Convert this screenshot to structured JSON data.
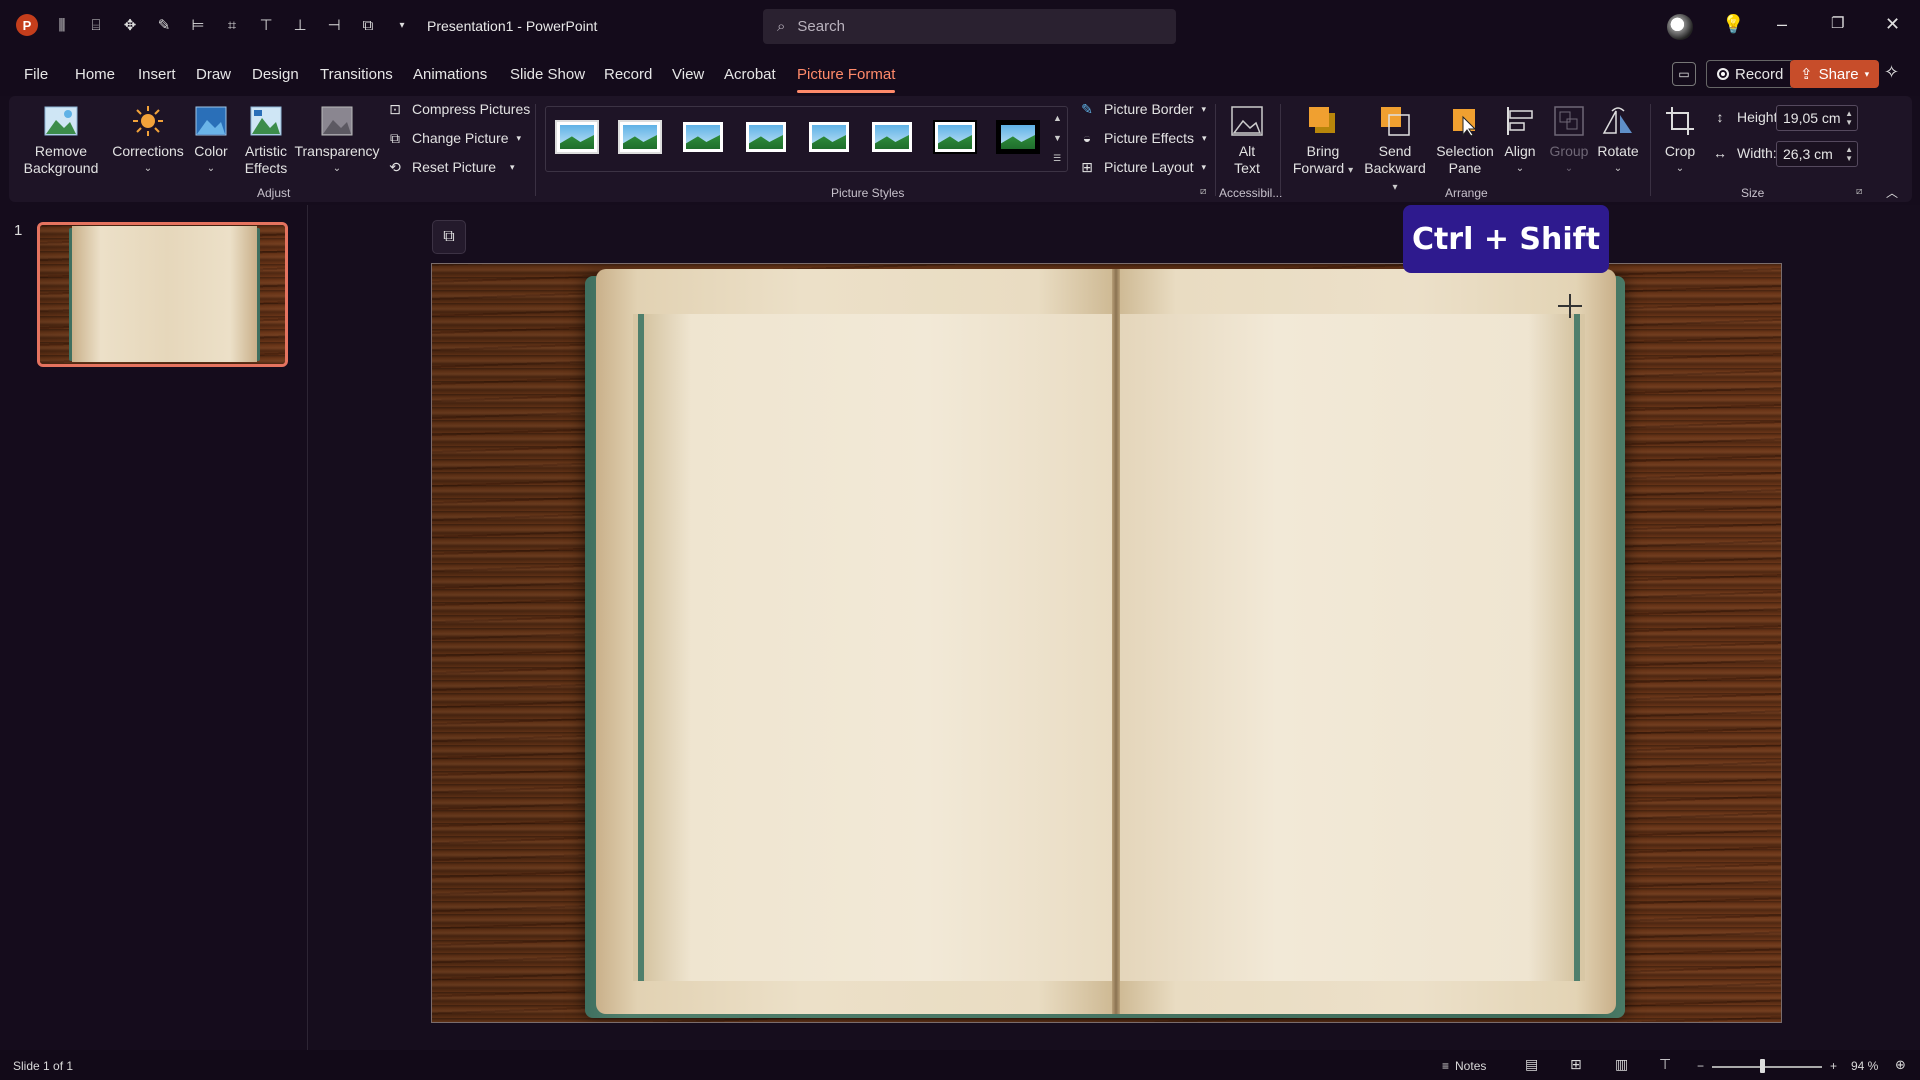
{
  "titlebar": {
    "app_logo": "P",
    "document_title": "Presentation1  -  PowerPoint",
    "search_placeholder": "Search",
    "win_minimize": "–",
    "win_restore": "❐",
    "win_close": "✕"
  },
  "menu": {
    "tabs": [
      "File",
      "Home",
      "Insert",
      "Draw",
      "Design",
      "Transitions",
      "Animations",
      "Slide Show",
      "Record",
      "View",
      "Acrobat",
      "Picture Format"
    ],
    "active_tab": "Picture Format",
    "record_label": "Record",
    "share_label": "Share"
  },
  "ribbon": {
    "adjust": {
      "remove_background": [
        "Remove",
        "Background"
      ],
      "corrections": "Corrections",
      "color": "Color",
      "artistic_effects": [
        "Artistic",
        "Effects"
      ],
      "transparency": "Transparency",
      "compress_pictures": "Compress Pictures",
      "change_picture": "Change Picture",
      "reset_picture": "Reset Picture",
      "group_label": "Adjust"
    },
    "picture_styles": {
      "picture_border": "Picture Border",
      "picture_effects": "Picture Effects",
      "picture_layout": "Picture Layout",
      "group_label": "Picture Styles"
    },
    "accessibility": {
      "alt_text": [
        "Alt",
        "Text"
      ],
      "group_label": "Accessibil..."
    },
    "arrange": {
      "bring_forward": [
        "Bring",
        "Forward"
      ],
      "send_backward": [
        "Send",
        "Backward"
      ],
      "selection_pane": [
        "Selection",
        "Pane"
      ],
      "align": "Align",
      "group": "Group",
      "rotate": "Rotate",
      "group_label": "Arrange"
    },
    "size": {
      "crop": "Crop",
      "height_label": "Height:",
      "height_value": "19,05 cm",
      "width_label": "Width:",
      "width_value": "26,3 cm",
      "group_label": "Size"
    }
  },
  "slides_pane": {
    "slide_number": "1"
  },
  "overlay": {
    "shortcut_text": "Ctrl + Shift"
  },
  "statusbar": {
    "slide_info": "Slide 1 of 1",
    "notes": "Notes",
    "zoom_level": "94 %",
    "zoom_minus": "−",
    "zoom_plus": "+"
  },
  "colors": {
    "accent": "#ff8a6a",
    "share_bg": "#c74d2a",
    "badge_bg": "#2e1a8e",
    "thumb_border": "#e5735f"
  }
}
